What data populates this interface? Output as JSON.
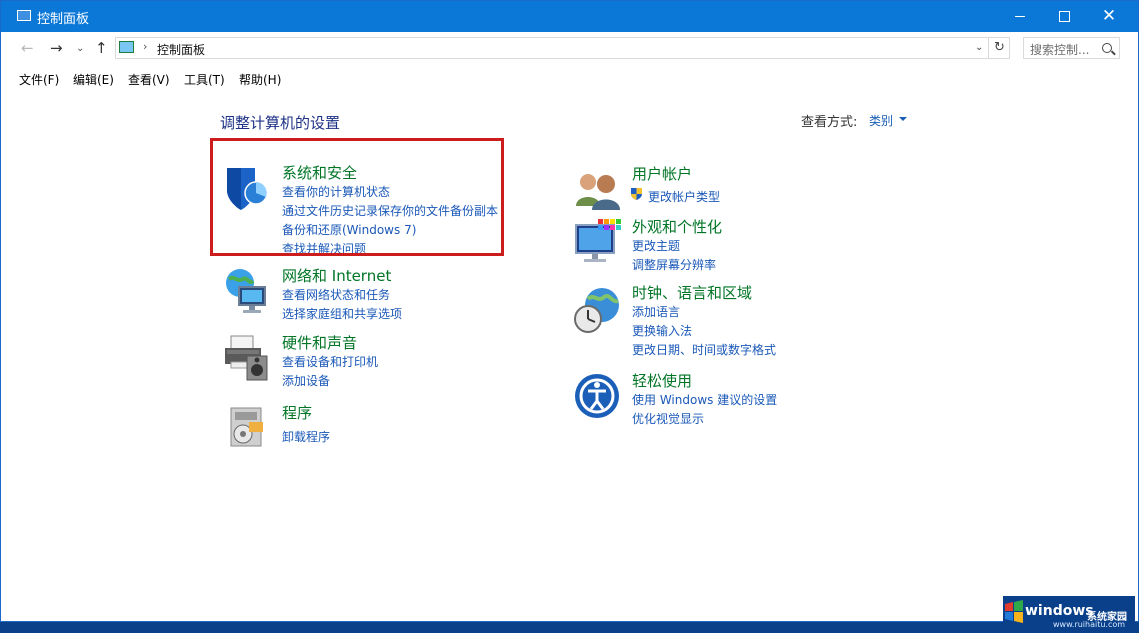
{
  "window": {
    "title": "控制面板"
  },
  "window_controls": {
    "min": "—",
    "max": "☐",
    "close": "✕"
  },
  "nav": {
    "back": "←",
    "forward": "→",
    "recent": "⌄",
    "up": "↑",
    "address_separator": "›",
    "address": "控制面板",
    "address_dropdown": "⌄",
    "refresh": "↻",
    "search_placeholder": "搜索控制..."
  },
  "menu": [
    "文件(F)",
    "编辑(E)",
    "查看(V)",
    "工具(T)",
    "帮助(H)"
  ],
  "heading": "调整计算机的设置",
  "view_by": {
    "label": "查看方式:",
    "value": "类别"
  },
  "categories_left": [
    {
      "title": "系统和安全",
      "links": [
        "查看你的计算机状态",
        "通过文件历史记录保存你的文件备份副本",
        "备份和还原(Windows 7)",
        "查找并解决问题"
      ]
    },
    {
      "title": "网络和 Internet",
      "links": [
        "查看网络状态和任务",
        "选择家庭组和共享选项"
      ]
    },
    {
      "title": "硬件和声音",
      "links": [
        "查看设备和打印机",
        "添加设备"
      ]
    },
    {
      "title": "程序",
      "links": [
        "卸载程序"
      ]
    }
  ],
  "categories_right": [
    {
      "title": "用户帐户",
      "links": [
        "更改帐户类型"
      ]
    },
    {
      "title": "外观和个性化",
      "links": [
        "更改主题",
        "调整屏幕分辨率"
      ]
    },
    {
      "title": "时钟、语言和区域",
      "links": [
        "添加语言",
        "更换输入法",
        "更改日期、时间或数字格式"
      ]
    },
    {
      "title": "轻松使用",
      "links": [
        "使用 Windows 建议的设置",
        "优化视觉显示"
      ]
    }
  ],
  "watermark": {
    "brand": "windows",
    "suffix": "系统家园",
    "url": "www.ruihaitu.com"
  },
  "colors": {
    "titlebar": "#0b78d8",
    "category_title": "#007526",
    "link": "#1a58b8",
    "highlight": "#cc1c1c"
  }
}
